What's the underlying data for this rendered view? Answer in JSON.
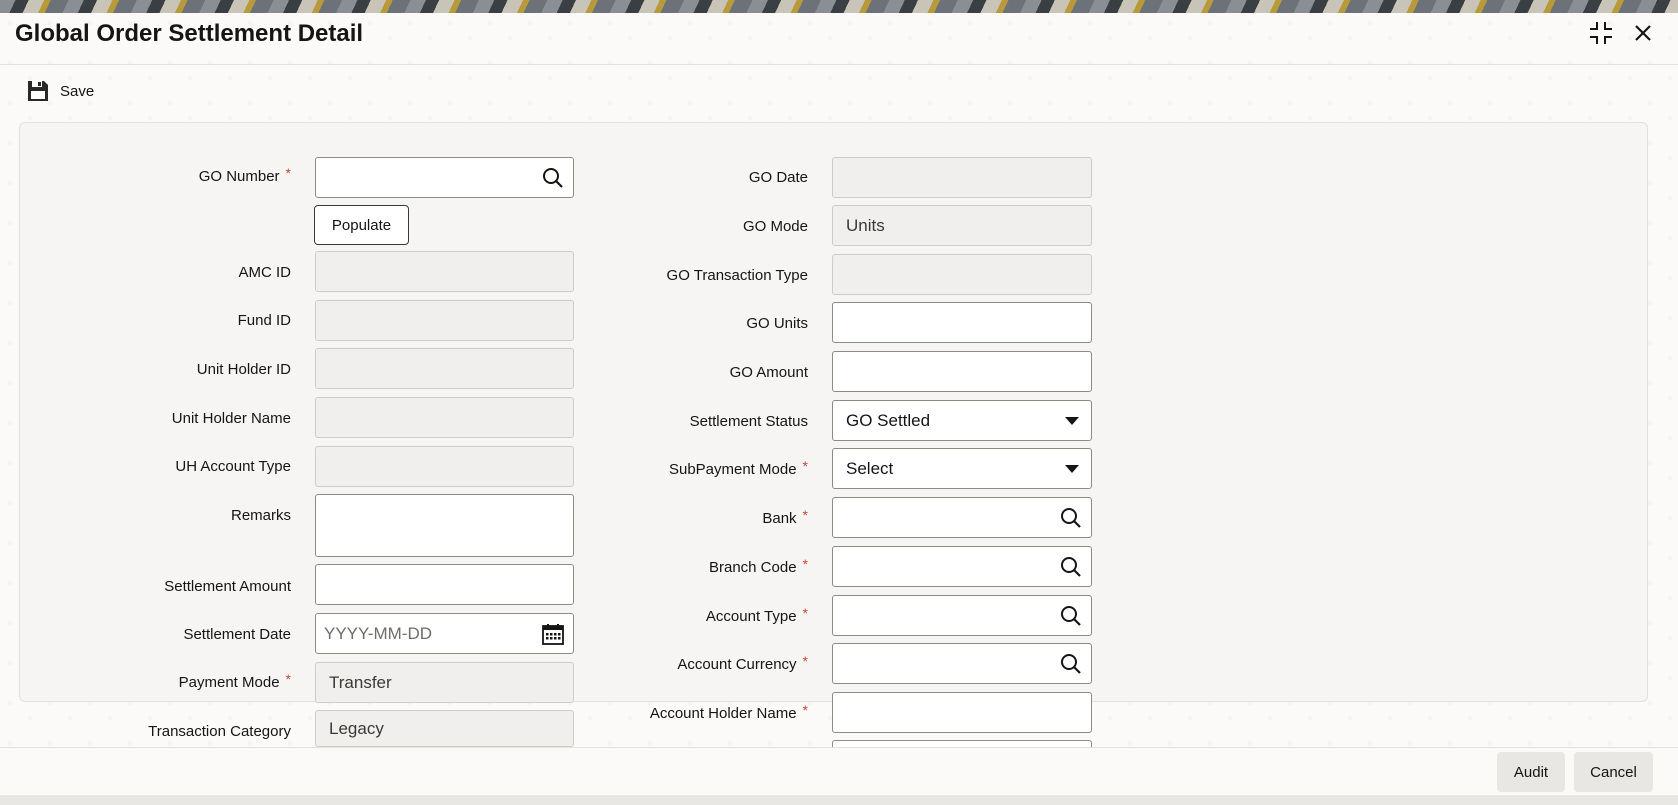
{
  "window": {
    "title": "Global Order Settlement Detail"
  },
  "toolbar": {
    "save_label": "Save"
  },
  "left_fields": {
    "go_number": {
      "label": "GO Number",
      "value": ""
    },
    "populate_label": "Populate",
    "amc_id": {
      "label": "AMC ID",
      "value": ""
    },
    "fund_id": {
      "label": "Fund ID",
      "value": ""
    },
    "unit_holder_id": {
      "label": "Unit Holder ID",
      "value": ""
    },
    "unit_holder_name": {
      "label": "Unit Holder Name",
      "value": ""
    },
    "uh_account_type": {
      "label": "UH Account Type",
      "value": ""
    },
    "remarks": {
      "label": "Remarks",
      "value": ""
    },
    "settlement_amount": {
      "label": "Settlement Amount",
      "value": ""
    },
    "settlement_date": {
      "label": "Settlement Date",
      "placeholder": "YYYY-MM-DD"
    },
    "payment_mode": {
      "label": "Payment Mode",
      "value": "Transfer"
    },
    "transaction_category": {
      "label": "Transaction Category",
      "value": "Legacy"
    }
  },
  "right_fields": {
    "go_date": {
      "label": "GO Date",
      "value": ""
    },
    "go_mode": {
      "label": "GO Mode",
      "value": "Units"
    },
    "go_transaction_type": {
      "label": "GO Transaction Type",
      "value": ""
    },
    "go_units": {
      "label": "GO Units",
      "value": ""
    },
    "go_amount": {
      "label": "GO Amount",
      "value": ""
    },
    "settlement_status": {
      "label": "Settlement Status",
      "value": "GO Settled"
    },
    "subpayment_mode": {
      "label": "SubPayment Mode",
      "value": "Select"
    },
    "bank": {
      "label": "Bank",
      "value": ""
    },
    "branch_code": {
      "label": "Branch Code",
      "value": ""
    },
    "account_type": {
      "label": "Account Type",
      "value": ""
    },
    "account_currency": {
      "label": "Account Currency",
      "value": ""
    },
    "account_holder_name": {
      "label": "Account Holder Name",
      "value": ""
    }
  },
  "required_marker": "*",
  "footer": {
    "audit_label": "Audit",
    "cancel_label": "Cancel"
  },
  "icons": {
    "maximize": "collapse-arrows-icon",
    "close": "close-icon",
    "save": "floppy-disk-icon",
    "search": "search-icon",
    "calendar": "calendar-icon",
    "dropdown": "chevron-down-icon"
  },
  "colors": {
    "required": "#c74634",
    "text": "#161513",
    "field_readonly": "#f1efed"
  }
}
